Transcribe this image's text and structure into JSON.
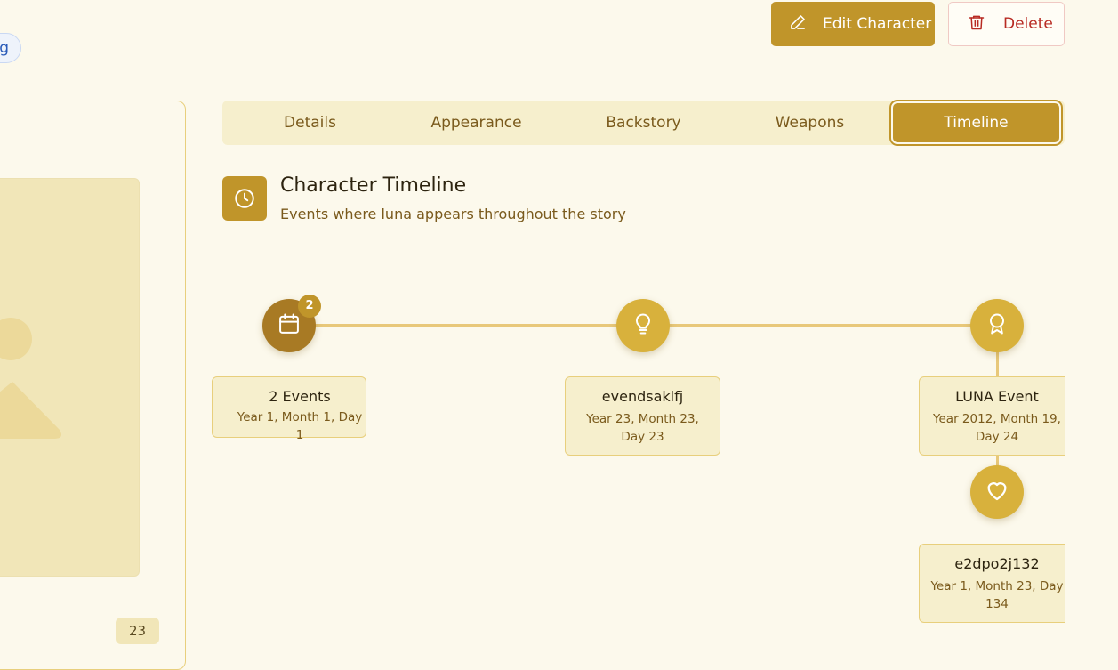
{
  "header": {
    "chip_text": "g",
    "edit_label": "Edit Character",
    "delete_label": "Delete"
  },
  "left_panel": {
    "counter": "23"
  },
  "tabs": [
    {
      "label": "Details"
    },
    {
      "label": "Appearance"
    },
    {
      "label": "Backstory"
    },
    {
      "label": "Weapons"
    },
    {
      "label": "Timeline",
      "active": true
    }
  ],
  "timeline": {
    "title": "Character Timeline",
    "subtitle": "Events where luna appears throughout the story",
    "events": [
      {
        "title": "2 Events",
        "date": "Year 1, Month 1, Day 1",
        "badge": "2",
        "icon": "calendar-icon"
      },
      {
        "title": "evendsaklfj",
        "date": "Year 23, Month 23, Day 23",
        "icon": "lightbulb-icon"
      },
      {
        "title": "LUNA Event",
        "date": "Year 2012, Month 19, Day 24",
        "icon": "award-icon"
      },
      {
        "title": "e2dpo2j132",
        "date": "Year 1, Month 23, Day 134",
        "icon": "heart-icon"
      }
    ]
  },
  "colors": {
    "accent": "#c0952a",
    "background": "#fcf9ec",
    "danger": "#b82b23"
  }
}
